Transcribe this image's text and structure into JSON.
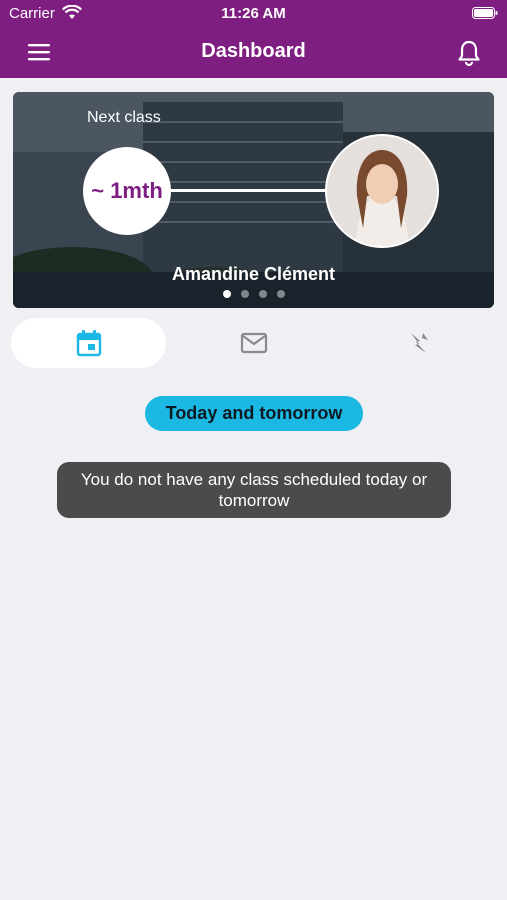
{
  "status_bar": {
    "carrier": "Carrier",
    "time": "11:26 AM"
  },
  "header": {
    "title": "Dashboard",
    "menu_icon": "hamburger-menu-icon",
    "notification_icon": "bell-icon",
    "background_color": "#7e1e80"
  },
  "next_class_card": {
    "label": "Next class",
    "countdown": "~ 1mth",
    "teacher_name": "Amandine Clément",
    "carousel_pages": 4,
    "active_page": 1
  },
  "tabs": [
    {
      "name": "calendar",
      "icon": "calendar-icon",
      "active": true
    },
    {
      "name": "messages",
      "icon": "mail-icon",
      "active": false
    },
    {
      "name": "activity",
      "icon": "lightning-icon",
      "active": false
    }
  ],
  "filter_pill": {
    "label": "Today and tomorrow",
    "color": "#1ab8e3"
  },
  "empty_message": "You do not have any class scheduled today or tomorrow",
  "accent_color": "#7e1e80"
}
